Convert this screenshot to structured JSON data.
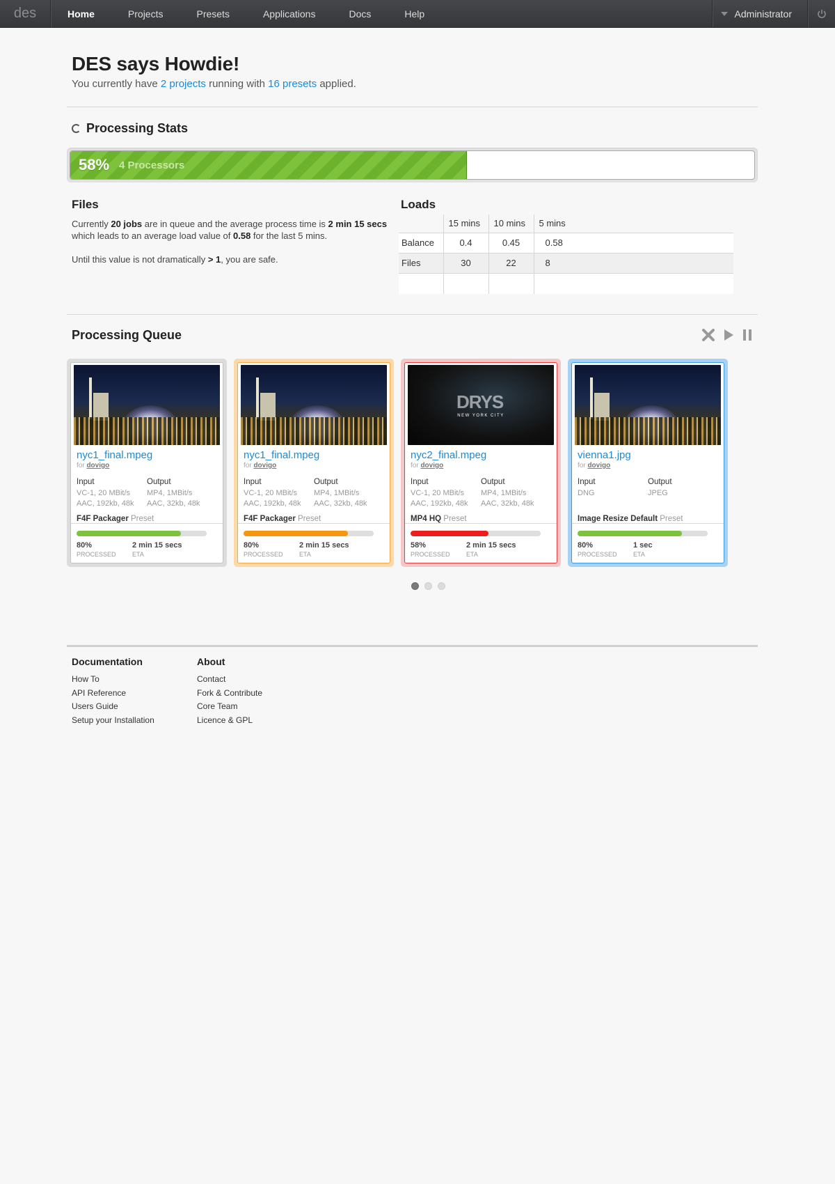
{
  "nav": {
    "brand": "des",
    "items": [
      {
        "label": "Home",
        "active": true
      },
      {
        "label": "Projects"
      },
      {
        "label": "Presets"
      },
      {
        "label": "Applications"
      },
      {
        "label": "Docs"
      },
      {
        "label": "Help"
      }
    ],
    "user": "Administrator"
  },
  "hero": {
    "title": "DES says Howdie!",
    "text_before": "You currently have ",
    "projects_link": "2 projects",
    "text_middle": " running with ",
    "presets_link": "16 presets",
    "text_after": " applied."
  },
  "stats": {
    "title": "Processing Stats",
    "percent_label": "58%",
    "percent_value": 58,
    "processors": "4 Processors",
    "fill_color": "#7ec13a"
  },
  "files": {
    "title": "Files",
    "p1_a": "Currently ",
    "p1_jobs": "20 jobs",
    "p1_b": " are in queue and the average process time is ",
    "p1_time": "2 min 15 secs",
    "p1_c": " which leads to an average load value of ",
    "p1_load": "0.58",
    "p1_d": " for the last 5 mins.",
    "p2_a": "Until this value is not dramatically ",
    "p2_b": "> 1",
    "p2_c": ", you are safe."
  },
  "loads": {
    "title": "Loads",
    "columns": [
      "15 mins",
      "10 mins",
      "5 mins"
    ],
    "rows": [
      {
        "label": "Balance",
        "values": [
          "0.4",
          "0.45",
          "0.58"
        ]
      },
      {
        "label": "Files",
        "values": [
          "30",
          "22",
          "8"
        ]
      }
    ]
  },
  "queue": {
    "title": "Processing Queue",
    "input_label": "Input",
    "output_label": "Output",
    "preset_suffix": "Preset",
    "processed_label": "PROCESSED",
    "eta_label": "ETA",
    "for_label": "for",
    "cards": [
      {
        "title": "nyc1_final.mpeg",
        "owner": "dovigo",
        "input": [
          "VC-1, 20 MBit/s",
          "AAC, 192kb, 48k"
        ],
        "output": [
          "MP4, 1MBit/s",
          "AAC, 32kb, 48k"
        ],
        "preset": "F4F Packager",
        "processed": "80%",
        "progress": 0.8,
        "eta": "2 min 15 secs",
        "bar_color": "#7ec13a",
        "state": "default"
      },
      {
        "title": "nyc1_final.mpeg",
        "owner": "dovigo",
        "input": [
          "VC-1, 20 MBit/s",
          "AAC, 192kb, 48k"
        ],
        "output": [
          "MP4, 1MBit/s",
          "AAC, 32kb, 48k"
        ],
        "preset": "F4F Packager",
        "processed": "80%",
        "progress": 0.8,
        "eta": "2 min 15 secs",
        "bar_color": "#f7950f",
        "state": "orange"
      },
      {
        "title": "nyc2_final.mpeg",
        "owner": "dovigo",
        "input": [
          "VC-1, 20 MBit/s",
          "AAC, 192kb, 48k"
        ],
        "output": [
          "MP4, 1MBit/s",
          "AAC, 32kb, 48k"
        ],
        "preset": "MP4 HQ",
        "processed": "58%",
        "progress": 0.6,
        "eta": "2 min 15 secs",
        "bar_color": "#ee1c1c",
        "state": "red",
        "thumb_text": "NEW YORK CITY"
      },
      {
        "title": "vienna1.jpg",
        "owner": "dovigo",
        "input": [
          "DNG"
        ],
        "output": [
          "JPEG"
        ],
        "preset": "Image Resize Default",
        "processed": "80%",
        "progress": 0.8,
        "eta": "1 sec",
        "bar_color": "#7ec13a",
        "state": "blue"
      }
    ],
    "pages": 3,
    "current_page": 1
  },
  "footer": {
    "doc_title": "Documentation",
    "doc_links": [
      "How To",
      "API Reference",
      "Users Guide",
      "Setup your Installation"
    ],
    "about_title": "About",
    "about_links": [
      "Contact",
      "Fork & Contribute",
      "Core Team",
      "Licence & GPL"
    ]
  }
}
